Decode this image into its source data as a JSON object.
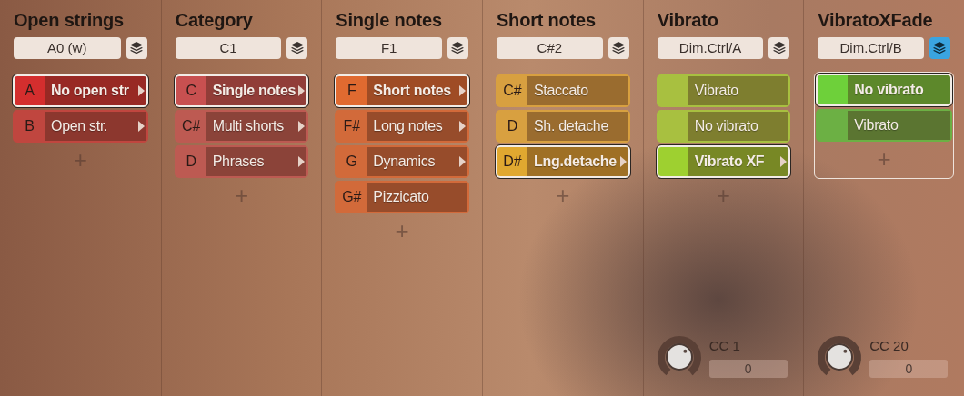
{
  "columns": [
    {
      "title": "Open strings",
      "key": "A0 (w)",
      "layers_active": false,
      "focused": false,
      "items": [
        {
          "note": "A",
          "label": "No open str",
          "selected": true,
          "submenu": true,
          "color": "#d42e2e"
        },
        {
          "note": "B",
          "label": "Open str.",
          "selected": false,
          "submenu": true,
          "color": "#c0463f"
        }
      ],
      "add": "+"
    },
    {
      "title": "Category",
      "key": "C1",
      "layers_active": false,
      "focused": false,
      "items": [
        {
          "note": "C",
          "label": "Single notes",
          "selected": true,
          "submenu": true,
          "color": "#c85050"
        },
        {
          "note": "C#",
          "label": "Multi shorts",
          "selected": false,
          "submenu": true,
          "color": "#bd5a52"
        },
        {
          "note": "D",
          "label": "Phrases",
          "selected": false,
          "submenu": true,
          "color": "#bd5a52"
        }
      ],
      "add": "+"
    },
    {
      "title": "Single notes",
      "key": "F1",
      "layers_active": false,
      "focused": false,
      "items": [
        {
          "note": "F",
          "label": "Short notes",
          "selected": true,
          "submenu": true,
          "color": "#e06a30"
        },
        {
          "note": "F#",
          "label": "Long notes",
          "selected": false,
          "submenu": true,
          "color": "#d26a3a"
        },
        {
          "note": "G",
          "label": "Dynamics",
          "selected": false,
          "submenu": true,
          "color": "#d26a3a"
        },
        {
          "note": "G#",
          "label": "Pizzicato",
          "selected": false,
          "submenu": false,
          "color": "#d26a3a"
        }
      ],
      "add": "+"
    },
    {
      "title": "Short notes",
      "key": "C#2",
      "layers_active": false,
      "focused": false,
      "items": [
        {
          "note": "C#",
          "label": "Staccato",
          "selected": false,
          "submenu": false,
          "color": "#d8a040"
        },
        {
          "note": "D",
          "label": "Sh. detache",
          "selected": false,
          "submenu": false,
          "color": "#d8a040"
        },
        {
          "note": "D#",
          "label": "Lng.detache",
          "selected": true,
          "submenu": true,
          "color": "#e0a830"
        }
      ],
      "add": "+"
    },
    {
      "title": "Vibrato",
      "key": "Dim.Ctrl/A",
      "layers_active": false,
      "focused": false,
      "items": [
        {
          "label": "Vibrato",
          "selected": false,
          "submenu": false,
          "color": "#a8c040"
        },
        {
          "label": "No vibrato",
          "selected": false,
          "submenu": false,
          "color": "#a8c040"
        },
        {
          "label": "Vibrato XF",
          "selected": true,
          "submenu": true,
          "color": "#9ed030"
        }
      ],
      "add": "+",
      "knob": {
        "label": "CC 1",
        "value": "0"
      }
    },
    {
      "title": "VibratoXFade",
      "key": "Dim.Ctrl/B",
      "layers_active": true,
      "focused": true,
      "items": [
        {
          "label": "No vibrato",
          "selected": true,
          "submenu": false,
          "color": "#6ed03a"
        },
        {
          "label": "Vibrato",
          "selected": false,
          "submenu": false,
          "color": "#6cb044"
        }
      ],
      "add": "+",
      "knob": {
        "label": "CC 20",
        "value": "0"
      }
    }
  ]
}
